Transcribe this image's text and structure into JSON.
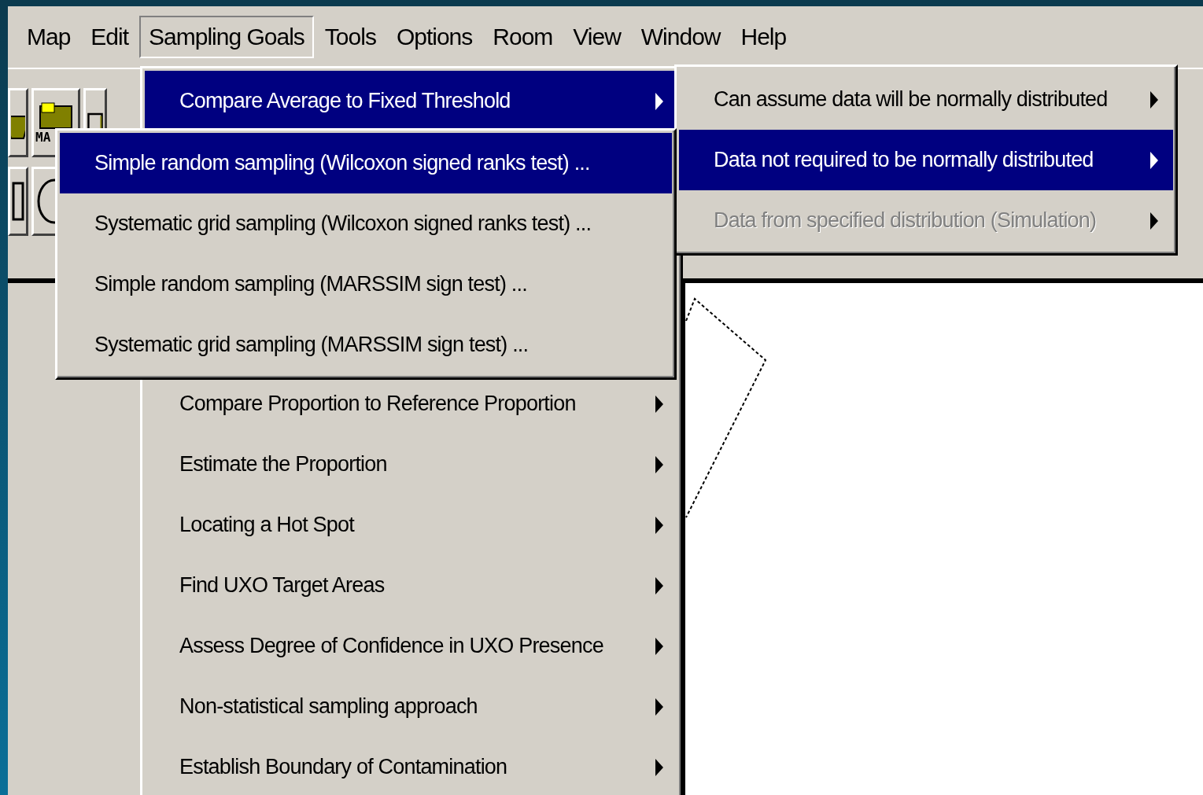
{
  "menu_bar": [
    {
      "label": "Map",
      "selected": false
    },
    {
      "label": "Edit",
      "selected": false
    },
    {
      "label": "Sampling Goals",
      "selected": true
    },
    {
      "label": "Tools",
      "selected": false
    },
    {
      "label": "Options",
      "selected": false
    },
    {
      "label": "Room",
      "selected": false
    },
    {
      "label": "View",
      "selected": false
    },
    {
      "label": "Window",
      "selected": false
    },
    {
      "label": "Help",
      "selected": false
    }
  ],
  "toolbar": {
    "folder_label": "MA"
  },
  "sampling_goals_menu": {
    "items": [
      {
        "label": "Compare Average to Fixed Threshold",
        "selected": true,
        "submenu": true
      },
      {
        "kind": "hidden"
      },
      {
        "label": "Compare Proportion to Reference Proportion",
        "selected": false,
        "submenu": true
      },
      {
        "label": "Estimate the Proportion",
        "selected": false,
        "submenu": true
      },
      {
        "label": "Locating a Hot Spot",
        "selected": false,
        "submenu": true
      },
      {
        "label": "Find UXO Target Areas",
        "selected": false,
        "submenu": true
      },
      {
        "label": "Assess Degree of Confidence in UXO Presence",
        "selected": false,
        "submenu": true
      },
      {
        "label": "Non-statistical sampling approach",
        "selected": false,
        "submenu": true
      },
      {
        "label": "Establish Boundary of Contamination",
        "selected": false,
        "submenu": true
      }
    ]
  },
  "distribution_submenu": {
    "items": [
      {
        "label": "Can assume data will be normally distributed",
        "selected": false,
        "disabled": false,
        "submenu": true
      },
      {
        "label": "Data not required to be normally distributed",
        "selected": true,
        "disabled": false,
        "submenu": true
      },
      {
        "label": "Data from specified distribution (Simulation)",
        "selected": false,
        "disabled": true,
        "submenu": true
      }
    ]
  },
  "test_submenu": {
    "items": [
      {
        "label": "Simple random sampling (Wilcoxon signed ranks test) ...",
        "selected": true,
        "submenu": false
      },
      {
        "label": "Systematic grid sampling (Wilcoxon signed ranks test) ...",
        "selected": false,
        "submenu": false
      },
      {
        "label": "Simple random sampling (MARSSIM sign test) ...",
        "selected": false,
        "submenu": false
      },
      {
        "label": "Systematic grid sampling (MARSSIM sign test) ...",
        "selected": false,
        "submenu": false
      }
    ]
  }
}
